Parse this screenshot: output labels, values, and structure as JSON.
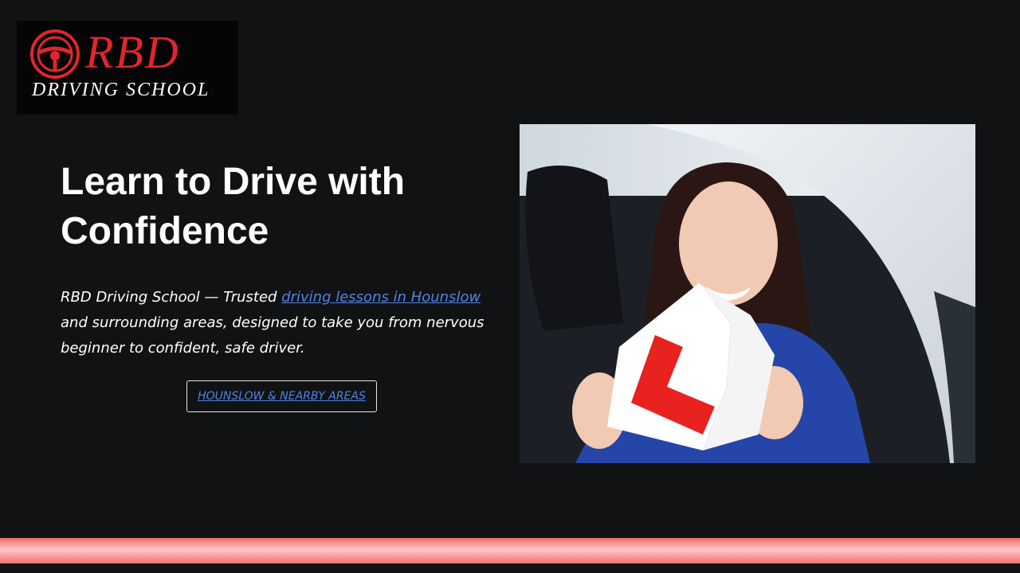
{
  "logo": {
    "brand": "RBD",
    "subtitle": "DRIVING SCHOOL",
    "icon": "steering-wheel-icon",
    "colors": {
      "brand": "#e0262b",
      "background": "#050505"
    }
  },
  "hero": {
    "headline": "Learn to Drive with Confidence",
    "intro": {
      "brand_text": "RBD Driving School",
      "before_link": " — Trusted ",
      "link_text": "driving lessons in Hounslow ",
      "after_link": "and surrounding areas, designed to take you from nervous beginner to confident, safe driver."
    },
    "cta_label": "HOUNSLOW & NEARBY AREAS"
  },
  "photo": {
    "subject": "smiling-learner-driver-with-torn-l-plate",
    "colors": {
      "l_plate": "#e8231f"
    }
  },
  "theme": {
    "background": "#111214",
    "link": "#4f84e8",
    "footer_bar": "#f47474"
  }
}
